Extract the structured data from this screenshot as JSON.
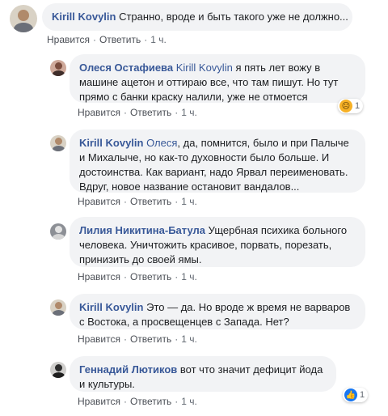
{
  "comments": [
    {
      "author": "Kirill Kovylin",
      "tag": "",
      "text": "Странно, вроде и быть такого уже не должно...",
      "like": "Нравится",
      "reply": "Ответить",
      "time": "1 ч.",
      "reaction": null
    },
    {
      "author": "Олеся Остафиева",
      "tag": "Kirill Kovylin",
      "text": "я пять лет вожу в машине ацетон и оттираю все, что там пишут. Но тут прямо с банки краску налили, уже не отмоется",
      "like": "Нравится",
      "reply": "Ответить",
      "time": "1 ч.",
      "reaction": {
        "icon": "sad-reaction-icon",
        "count": "1"
      }
    },
    {
      "author": "Kirill Kovylin",
      "tag": "Олеся",
      "text": ", да, помнится, было и при Палыче и Михалыче, но как-то духовности было больше. И достоинства. Как вариант, надо Ярвал переименовать. Вдруг, новое название остановит вандалов...",
      "like": "Нравится",
      "reply": "Ответить",
      "time": "1 ч.",
      "reaction": null
    },
    {
      "author": "Лилия Никитина-Батула",
      "tag": "",
      "text": "Ущербная психика больного человека. Уничтожить красивое, порвать, порезать, принизить до своей ямы.",
      "like": "Нравится",
      "reply": "Ответить",
      "time": "1 ч.",
      "reaction": null
    },
    {
      "author": "Kirill Kovylin",
      "tag": "",
      "text": "Это — да. Но вроде ж время не варваров с Востока, а просвещенцев с Запада. Нет?",
      "like": "Нравится",
      "reply": "Ответить",
      "time": "1 ч.",
      "reaction": null
    },
    {
      "author": "Геннадий Лютиков",
      "tag": "",
      "text": "вот что значит дефицит йода и культуры.",
      "like": "Нравится",
      "reply": "Ответить",
      "time": "1 ч.",
      "reaction": {
        "icon": "like-reaction-icon",
        "count": "1"
      }
    }
  ],
  "colors": {
    "link": "#385898",
    "bubble": "#f2f3f5",
    "meta": "#606770",
    "like_blue": "#1877f2",
    "sad_yellow": "#f7b125"
  }
}
